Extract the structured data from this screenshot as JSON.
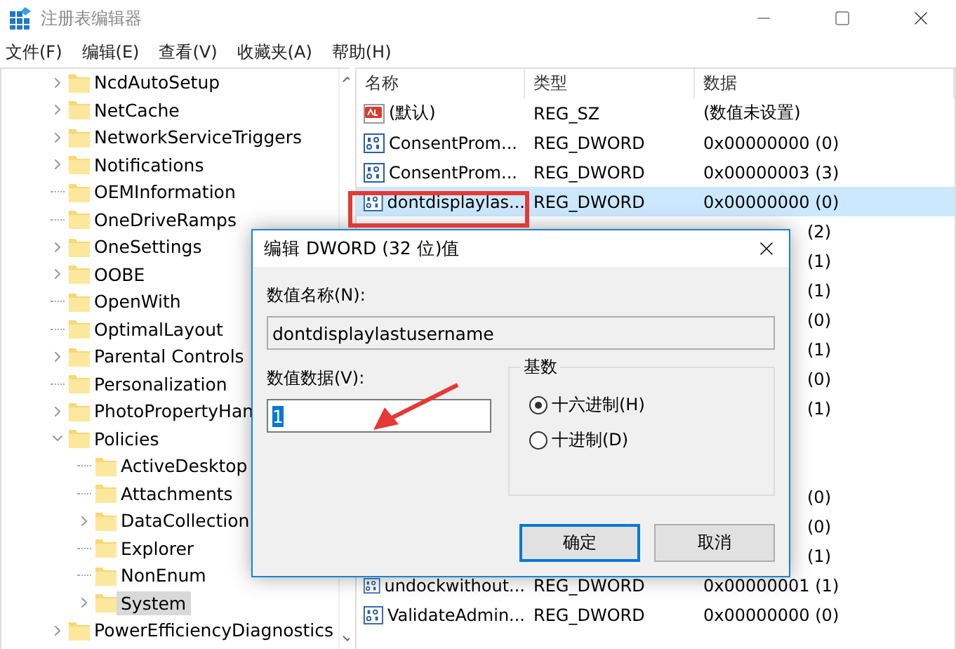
{
  "window": {
    "title": "注册表编辑器"
  },
  "menu": [
    "文件(F)",
    "编辑(E)",
    "查看(V)",
    "收藏夹(A)",
    "帮助(H)"
  ],
  "tree": {
    "items": [
      {
        "kind": "branch",
        "label": "NcdAutoSetup",
        "expanded": false,
        "selected": false
      },
      {
        "kind": "branch",
        "label": "NetCache",
        "expanded": false,
        "selected": false
      },
      {
        "kind": "branch",
        "label": "NetworkServiceTriggers",
        "expanded": false,
        "selected": false
      },
      {
        "kind": "branch",
        "label": "Notifications",
        "expanded": false,
        "selected": false
      },
      {
        "kind": "leaf",
        "label": "OEMInformation",
        "selected": false
      },
      {
        "kind": "leaf",
        "label": "OneDriveRamps",
        "selected": false
      },
      {
        "kind": "branch",
        "label": "OneSettings",
        "expanded": false,
        "selected": false
      },
      {
        "kind": "branch",
        "label": "OOBE",
        "expanded": false,
        "selected": false
      },
      {
        "kind": "leaf",
        "label": "OpenWith",
        "selected": false
      },
      {
        "kind": "leaf",
        "label": "OptimalLayout",
        "selected": false
      },
      {
        "kind": "branch",
        "label": "Parental Controls",
        "expanded": false,
        "selected": false
      },
      {
        "kind": "leaf",
        "label": "Personalization",
        "selected": false
      },
      {
        "kind": "branch",
        "label": "PhotoPropertyHan",
        "expanded": false,
        "selected": false
      },
      {
        "kind": "branch",
        "label": "Policies",
        "expanded": true,
        "selected": false,
        "children": [
          {
            "kind": "leaf",
            "label": "ActiveDesktop",
            "selected": false
          },
          {
            "kind": "leaf",
            "label": "Attachments",
            "selected": false
          },
          {
            "kind": "branch",
            "label": "DataCollection",
            "expanded": false,
            "selected": false
          },
          {
            "kind": "leaf",
            "label": "Explorer",
            "selected": false
          },
          {
            "kind": "leaf",
            "label": "NonEnum",
            "selected": false
          },
          {
            "kind": "branch",
            "label": "System",
            "expanded": false,
            "selected": true
          }
        ]
      },
      {
        "kind": "branch",
        "label": "PowerEfficiencyDiagnostics",
        "expanded": false,
        "selected": false
      }
    ]
  },
  "table": {
    "columns": [
      "名称",
      "类型",
      "数据"
    ],
    "rows": [
      {
        "kind": "string",
        "name": "(默认)",
        "type": "REG_SZ",
        "data": "(数值未设置)",
        "selected": false
      },
      {
        "kind": "dword",
        "name": "ConsentProm...",
        "type": "REG_DWORD",
        "data": "0x00000000 (0)",
        "selected": false
      },
      {
        "kind": "dword",
        "name": "ConsentProm...",
        "type": "REG_DWORD",
        "data": "0x00000003 (3)",
        "selected": false
      },
      {
        "kind": "dword",
        "name": "dontdisplaylas...",
        "type": "REG_DWORD",
        "data": "0x00000000 (0)",
        "selected": true
      },
      {
        "kind": "covered",
        "data": "(2)",
        "selected": false
      },
      {
        "kind": "covered",
        "data": "(1)",
        "selected": false
      },
      {
        "kind": "covered",
        "data": "(1)",
        "selected": false
      },
      {
        "kind": "covered",
        "data": "(0)",
        "selected": false
      },
      {
        "kind": "covered",
        "data": "(1)",
        "selected": false
      },
      {
        "kind": "covered",
        "data": "(0)",
        "selected": false
      },
      {
        "kind": "covered",
        "data": "(1)",
        "selected": false
      },
      {
        "kind": "covered",
        "selected": false
      },
      {
        "kind": "covered",
        "selected": false
      },
      {
        "kind": "covered",
        "data": "(0)",
        "selected": false
      },
      {
        "kind": "covered",
        "data": "(0)",
        "selected": false
      },
      {
        "kind": "covered",
        "data": "(1)",
        "selected": false
      },
      {
        "kind": "dword",
        "name": "undockwithout...",
        "type": "REG_DWORD",
        "data": "0x00000001 (1)",
        "selected": false
      },
      {
        "kind": "dword",
        "name": "ValidateAdmin...",
        "type": "REG_DWORD",
        "data": "0x00000000 (0)",
        "selected": false
      }
    ]
  },
  "dialog": {
    "title": "编辑 DWORD (32 位)值",
    "name_label": "数值名称(N):",
    "name_value": "dontdisplaylastusername",
    "data_label": "数值数据(V):",
    "data_value": "1",
    "data_value_selected": true,
    "base": {
      "label": "基数",
      "options": [
        {
          "label": "十六进制(H)",
          "selected": true
        },
        {
          "label": "十进制(D)",
          "selected": false
        }
      ]
    },
    "buttons": [
      {
        "label": "确定",
        "default": true
      },
      {
        "label": "取消",
        "default": false
      }
    ]
  },
  "annotations": {
    "highlight_box": true,
    "arrow": true
  }
}
